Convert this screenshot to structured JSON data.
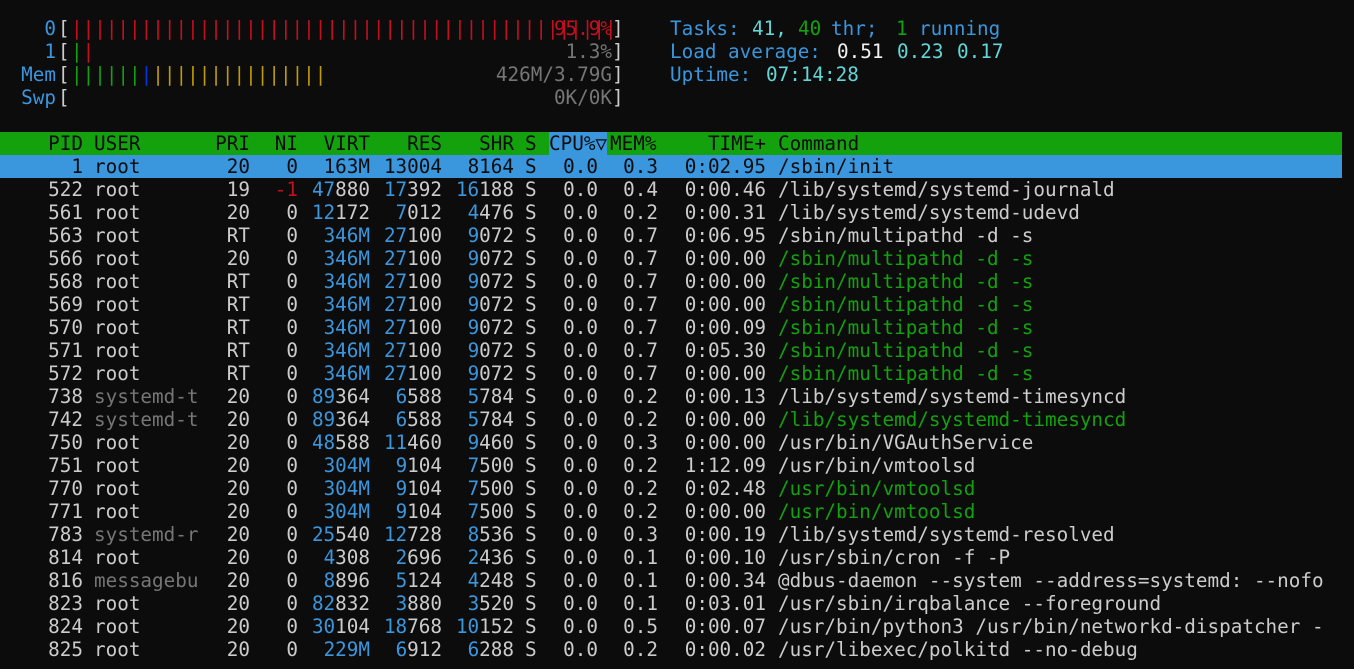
{
  "cpu0": {
    "label": "0",
    "value": "95.9%",
    "ticks": 47
  },
  "cpu1": {
    "label": "1",
    "value": "1.3%"
  },
  "mem": {
    "label": "Mem",
    "value": "426M/3.79G"
  },
  "swp": {
    "label": "Swp",
    "value": "0K/0K"
  },
  "tasks": {
    "label": "Tasks:",
    "count": "41,",
    "threads": "40",
    "thr_label": "thr;",
    "running": "1",
    "running_label": "running"
  },
  "load": {
    "label": "Load average:",
    "v1": "0.51",
    "v5": "0.23",
    "v15": "0.17"
  },
  "uptime": {
    "label": "Uptime:",
    "value": "07:14:28"
  },
  "columns": {
    "pid": "PID",
    "user": "USER",
    "pri": "PRI",
    "ni": "NI",
    "virt": "VIRT",
    "res": "RES",
    "shr": "SHR",
    "s": "S",
    "cpu": "CPU%▽",
    "mem": "MEM%",
    "time": "TIME+",
    "command": "Command"
  },
  "processes": [
    {
      "pid": "1",
      "user": "root",
      "pri": "20",
      "ni": "0",
      "virt": "163M",
      "res": "13004",
      "shr": "8164",
      "s": "S",
      "cpu": "0.0",
      "mem": "0.3",
      "time": "0:02.95",
      "command": "/sbin/init",
      "thread": false,
      "selected": true
    },
    {
      "pid": "522",
      "user": "root",
      "pri": "19",
      "ni": "-1",
      "virt": "47880",
      "res": "17392",
      "shr": "16188",
      "s": "S",
      "cpu": "0.0",
      "mem": "0.4",
      "time": "0:00.46",
      "command": "/lib/systemd/systemd-journald",
      "thread": false
    },
    {
      "pid": "561",
      "user": "root",
      "pri": "20",
      "ni": "0",
      "virt": "12172",
      "res": "7012",
      "shr": "4476",
      "s": "S",
      "cpu": "0.0",
      "mem": "0.2",
      "time": "0:00.31",
      "command": "/lib/systemd/systemd-udevd",
      "thread": false
    },
    {
      "pid": "563",
      "user": "root",
      "pri": "RT",
      "ni": "0",
      "virt": "346M",
      "res": "27100",
      "shr": "9072",
      "s": "S",
      "cpu": "0.0",
      "mem": "0.7",
      "time": "0:06.95",
      "command": "/sbin/multipathd -d -s",
      "thread": false
    },
    {
      "pid": "566",
      "user": "root",
      "pri": "20",
      "ni": "0",
      "virt": "346M",
      "res": "27100",
      "shr": "9072",
      "s": "S",
      "cpu": "0.0",
      "mem": "0.7",
      "time": "0:00.00",
      "command": "/sbin/multipathd -d -s",
      "thread": true
    },
    {
      "pid": "568",
      "user": "root",
      "pri": "RT",
      "ni": "0",
      "virt": "346M",
      "res": "27100",
      "shr": "9072",
      "s": "S",
      "cpu": "0.0",
      "mem": "0.7",
      "time": "0:00.00",
      "command": "/sbin/multipathd -d -s",
      "thread": true
    },
    {
      "pid": "569",
      "user": "root",
      "pri": "RT",
      "ni": "0",
      "virt": "346M",
      "res": "27100",
      "shr": "9072",
      "s": "S",
      "cpu": "0.0",
      "mem": "0.7",
      "time": "0:00.00",
      "command": "/sbin/multipathd -d -s",
      "thread": true
    },
    {
      "pid": "570",
      "user": "root",
      "pri": "RT",
      "ni": "0",
      "virt": "346M",
      "res": "27100",
      "shr": "9072",
      "s": "S",
      "cpu": "0.0",
      "mem": "0.7",
      "time": "0:00.09",
      "command": "/sbin/multipathd -d -s",
      "thread": true
    },
    {
      "pid": "571",
      "user": "root",
      "pri": "RT",
      "ni": "0",
      "virt": "346M",
      "res": "27100",
      "shr": "9072",
      "s": "S",
      "cpu": "0.0",
      "mem": "0.7",
      "time": "0:05.30",
      "command": "/sbin/multipathd -d -s",
      "thread": true
    },
    {
      "pid": "572",
      "user": "root",
      "pri": "RT",
      "ni": "0",
      "virt": "346M",
      "res": "27100",
      "shr": "9072",
      "s": "S",
      "cpu": "0.0",
      "mem": "0.7",
      "time": "0:00.00",
      "command": "/sbin/multipathd -d -s",
      "thread": true
    },
    {
      "pid": "738",
      "user": "systemd-t",
      "pri": "20",
      "ni": "0",
      "virt": "89364",
      "res": "6588",
      "shr": "5784",
      "s": "S",
      "cpu": "0.0",
      "mem": "0.2",
      "time": "0:00.13",
      "command": "/lib/systemd/systemd-timesyncd",
      "thread": false,
      "user_dim": true
    },
    {
      "pid": "742",
      "user": "systemd-t",
      "pri": "20",
      "ni": "0",
      "virt": "89364",
      "res": "6588",
      "shr": "5784",
      "s": "S",
      "cpu": "0.0",
      "mem": "0.2",
      "time": "0:00.00",
      "command": "/lib/systemd/systemd-timesyncd",
      "thread": true,
      "user_dim": true
    },
    {
      "pid": "750",
      "user": "root",
      "pri": "20",
      "ni": "0",
      "virt": "48588",
      "res": "11460",
      "shr": "9460",
      "s": "S",
      "cpu": "0.0",
      "mem": "0.3",
      "time": "0:00.00",
      "command": "/usr/bin/VGAuthService",
      "thread": false
    },
    {
      "pid": "751",
      "user": "root",
      "pri": "20",
      "ni": "0",
      "virt": "304M",
      "res": "9104",
      "shr": "7500",
      "s": "S",
      "cpu": "0.0",
      "mem": "0.2",
      "time": "1:12.09",
      "command": "/usr/bin/vmtoolsd",
      "thread": false
    },
    {
      "pid": "770",
      "user": "root",
      "pri": "20",
      "ni": "0",
      "virt": "304M",
      "res": "9104",
      "shr": "7500",
      "s": "S",
      "cpu": "0.0",
      "mem": "0.2",
      "time": "0:02.48",
      "command": "/usr/bin/vmtoolsd",
      "thread": true
    },
    {
      "pid": "771",
      "user": "root",
      "pri": "20",
      "ni": "0",
      "virt": "304M",
      "res": "9104",
      "shr": "7500",
      "s": "S",
      "cpu": "0.0",
      "mem": "0.2",
      "time": "0:00.00",
      "command": "/usr/bin/vmtoolsd",
      "thread": true
    },
    {
      "pid": "783",
      "user": "systemd-r",
      "pri": "20",
      "ni": "0",
      "virt": "25540",
      "res": "12728",
      "shr": "8536",
      "s": "S",
      "cpu": "0.0",
      "mem": "0.3",
      "time": "0:00.19",
      "command": "/lib/systemd/systemd-resolved",
      "thread": false,
      "user_dim": true
    },
    {
      "pid": "814",
      "user": "root",
      "pri": "20",
      "ni": "0",
      "virt": "4308",
      "res": "2696",
      "shr": "2436",
      "s": "S",
      "cpu": "0.0",
      "mem": "0.1",
      "time": "0:00.10",
      "command": "/usr/sbin/cron -f -P",
      "thread": false
    },
    {
      "pid": "816",
      "user": "messagebu",
      "pri": "20",
      "ni": "0",
      "virt": "8896",
      "res": "5124",
      "shr": "4248",
      "s": "S",
      "cpu": "0.0",
      "mem": "0.1",
      "time": "0:00.34",
      "command": "@dbus-daemon --system --address=systemd: --nofo",
      "thread": false,
      "user_dim": true
    },
    {
      "pid": "823",
      "user": "root",
      "pri": "20",
      "ni": "0",
      "virt": "82832",
      "res": "3880",
      "shr": "3520",
      "s": "S",
      "cpu": "0.0",
      "mem": "0.1",
      "time": "0:03.01",
      "command": "/usr/sbin/irqbalance --foreground",
      "thread": false
    },
    {
      "pid": "824",
      "user": "root",
      "pri": "20",
      "ni": "0",
      "virt": "30104",
      "res": "18768",
      "shr": "10152",
      "s": "S",
      "cpu": "0.0",
      "mem": "0.5",
      "time": "0:00.07",
      "command": "/usr/bin/python3 /usr/bin/networkd-dispatcher -",
      "thread": false
    },
    {
      "pid": "825",
      "user": "root",
      "pri": "20",
      "ni": "0",
      "virt": "229M",
      "res": "6912",
      "shr": "6288",
      "s": "S",
      "cpu": "0.0",
      "mem": "0.2",
      "time": "0:00.02",
      "command": "/usr/libexec/polkitd --no-debug",
      "thread": false
    }
  ],
  "colors": {
    "background": "#0c0c0c",
    "header_bg": "#13a10e",
    "selection_bg": "#3a96dd",
    "label_blue": "#3a96dd",
    "thread_green": "#13a10e",
    "high_red": "#c50f1f",
    "meter_yellow": "#c19c00"
  }
}
